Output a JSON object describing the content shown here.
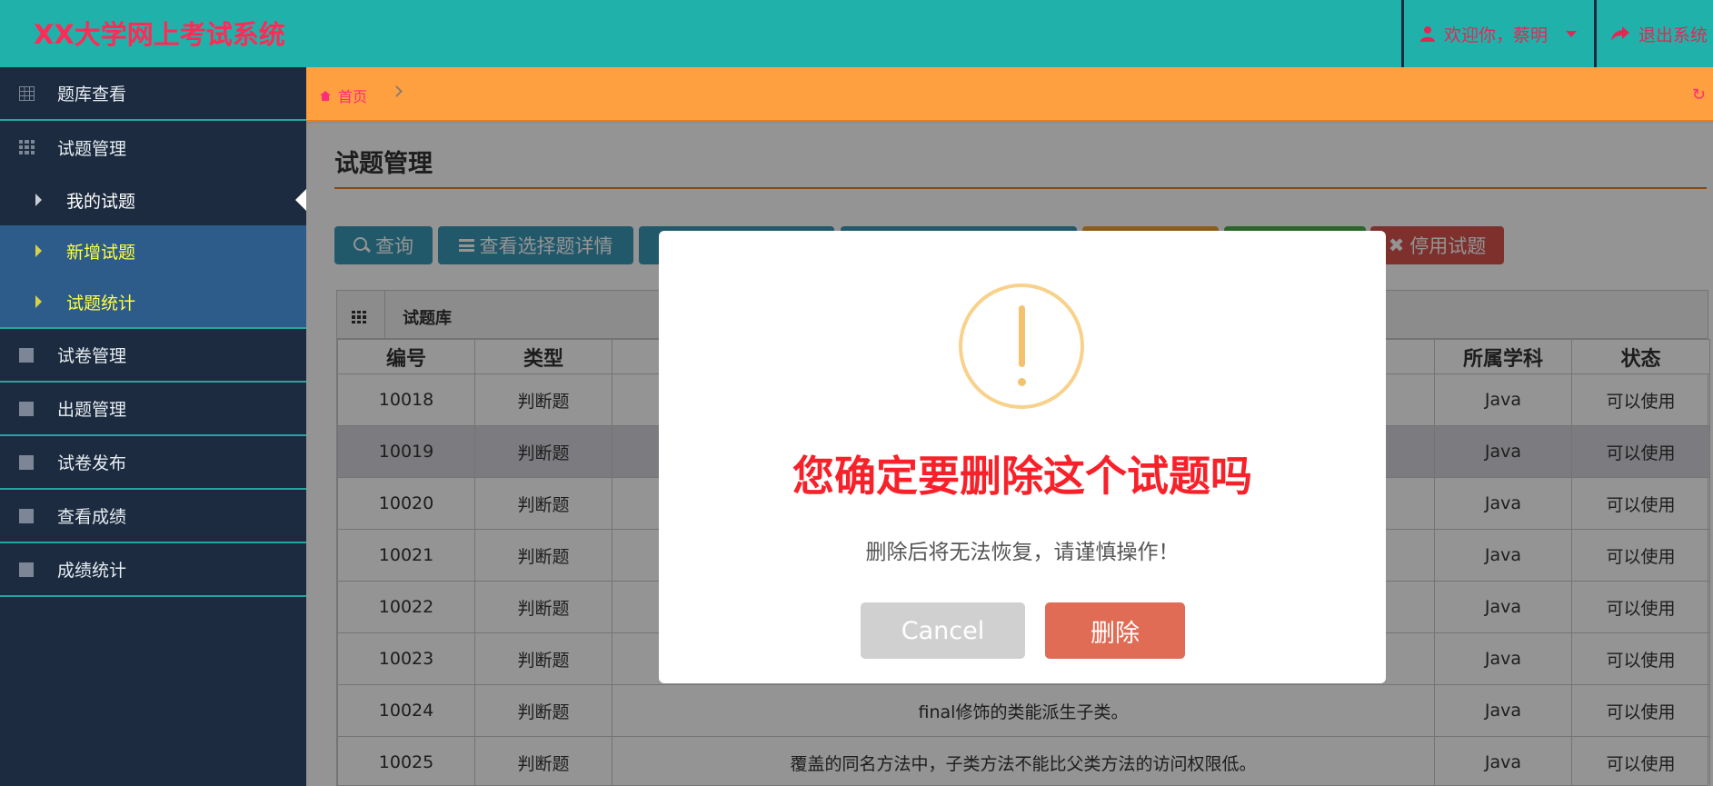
{
  "header": {
    "brand": "XX大学网上考试系统",
    "user_label": "欢迎你，蔡明",
    "logout_label": "退出系统"
  },
  "sidebar": {
    "items": [
      {
        "label": "题库查看",
        "icon": "table-icon"
      },
      {
        "label": "试题管理",
        "icon": "grid-icon"
      },
      {
        "label": "试卷管理",
        "icon": "square-icon"
      },
      {
        "label": "出题管理",
        "icon": "square-icon"
      },
      {
        "label": "试卷发布",
        "icon": "square-icon"
      },
      {
        "label": "查看成绩",
        "icon": "square-icon"
      },
      {
        "label": "成绩统计",
        "icon": "square-icon"
      }
    ],
    "subitems": [
      {
        "label": "我的试题",
        "active": true
      },
      {
        "label": "新增试题"
      },
      {
        "label": "试题统计"
      }
    ]
  },
  "breadcrumb": {
    "home": "首页"
  },
  "page": {
    "title": "试题管理"
  },
  "toolbar": {
    "query": "查询",
    "detail": "查看选择题详情",
    "disable": "停用试题"
  },
  "panel": {
    "title": "试题库"
  },
  "table": {
    "headers": {
      "id": "编号",
      "type": "类型",
      "subject": "所属学科",
      "status": "状态"
    },
    "rows": [
      {
        "id": "10018",
        "type": "判断题",
        "content": "",
        "subject": "Java",
        "status": "可以使用"
      },
      {
        "id": "10019",
        "type": "判断题",
        "content": "",
        "subject": "Java",
        "status": "可以使用"
      },
      {
        "id": "10020",
        "type": "判断题",
        "content": "",
        "subject": "Java",
        "status": "可以使用"
      },
      {
        "id": "10021",
        "type": "判断题",
        "content": "",
        "subject": "Java",
        "status": "可以使用"
      },
      {
        "id": "10022",
        "type": "判断题",
        "content": "",
        "subject": "Java",
        "status": "可以使用"
      },
      {
        "id": "10023",
        "type": "判断题",
        "content": "",
        "subject": "Java",
        "status": "可以使用"
      },
      {
        "id": "10024",
        "type": "判断题",
        "content": "final修饰的类能派生子类。",
        "subject": "Java",
        "status": "可以使用"
      },
      {
        "id": "10025",
        "type": "判断题",
        "content": "覆盖的同名方法中，子类方法不能比父类方法的访问权限低。",
        "subject": "Java",
        "status": "可以使用"
      }
    ]
  },
  "dialog": {
    "title": "您确定要删除这个试题吗",
    "text": "删除后将无法恢复，请谨慎操作！",
    "cancel": "Cancel",
    "confirm": "删除"
  },
  "colors": {
    "header_bg": "#20b2aa",
    "brand": "#ff2a55",
    "sidebar_bg": "#1c2b3f",
    "breadcrumb_bg": "#ffa040",
    "dialog_title": "#f7212a",
    "confirm_btn": "#e06c55"
  }
}
